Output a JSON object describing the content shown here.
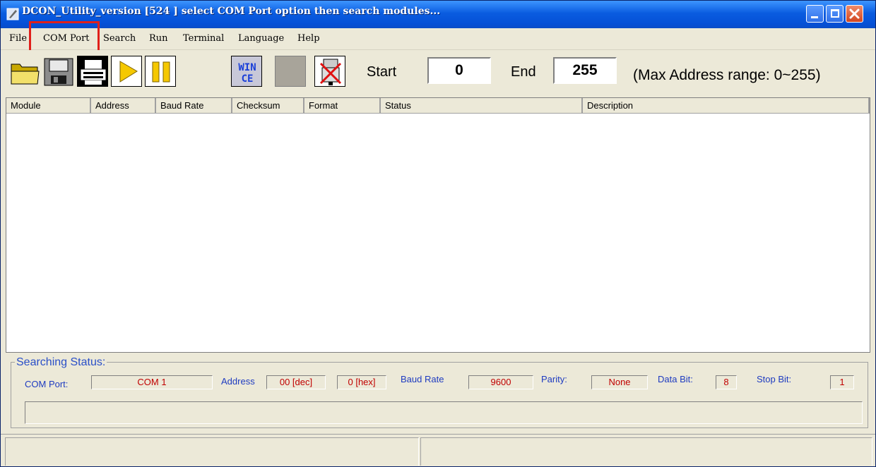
{
  "window": {
    "title": "DCON_Utility_version [524 ] select COM Port option then search modules...",
    "controls": [
      "minimize-icon",
      "maximize-icon",
      "close-icon"
    ]
  },
  "menu": {
    "items": [
      "File",
      "COM Port",
      "Search",
      "Run",
      "Terminal",
      "Language",
      "Help"
    ]
  },
  "toolbar": {
    "buttons": [
      "open-folder-icon",
      "save-disk-icon",
      "print-icon",
      "run-play-icon",
      "pause-icon",
      "wince-icon",
      "blank-button",
      "stop-connect-icon"
    ],
    "wince_label": "WIN CE",
    "start_label": "Start",
    "start_value": "0",
    "end_label": "End",
    "end_value": "255",
    "range_hint": "(Max Address range: 0~255)"
  },
  "list": {
    "columns": [
      "Module",
      "Address",
      "Baud Rate",
      "Checksum",
      "Format",
      "Status",
      "Description"
    ],
    "rows": []
  },
  "searching_status": {
    "title": "Searching Status:",
    "com_port_label": "COM Port:",
    "com_port_value": "COM 1",
    "address_label": "Address",
    "address_dec": "00 [dec]",
    "address_hex": "0 [hex]",
    "baud_label": "Baud Rate",
    "baud_value": "9600",
    "parity_label": "Parity:",
    "parity_value": "None",
    "databit_label": "Data Bit:",
    "databit_value": "8",
    "stopbit_label": "Stop Bit:",
    "stopbit_value": "1"
  },
  "colors": {
    "title_bar": "#0550d6",
    "highlight": "#e0201a",
    "status_label": "#1e3bc0",
    "status_value": "#c00000"
  }
}
